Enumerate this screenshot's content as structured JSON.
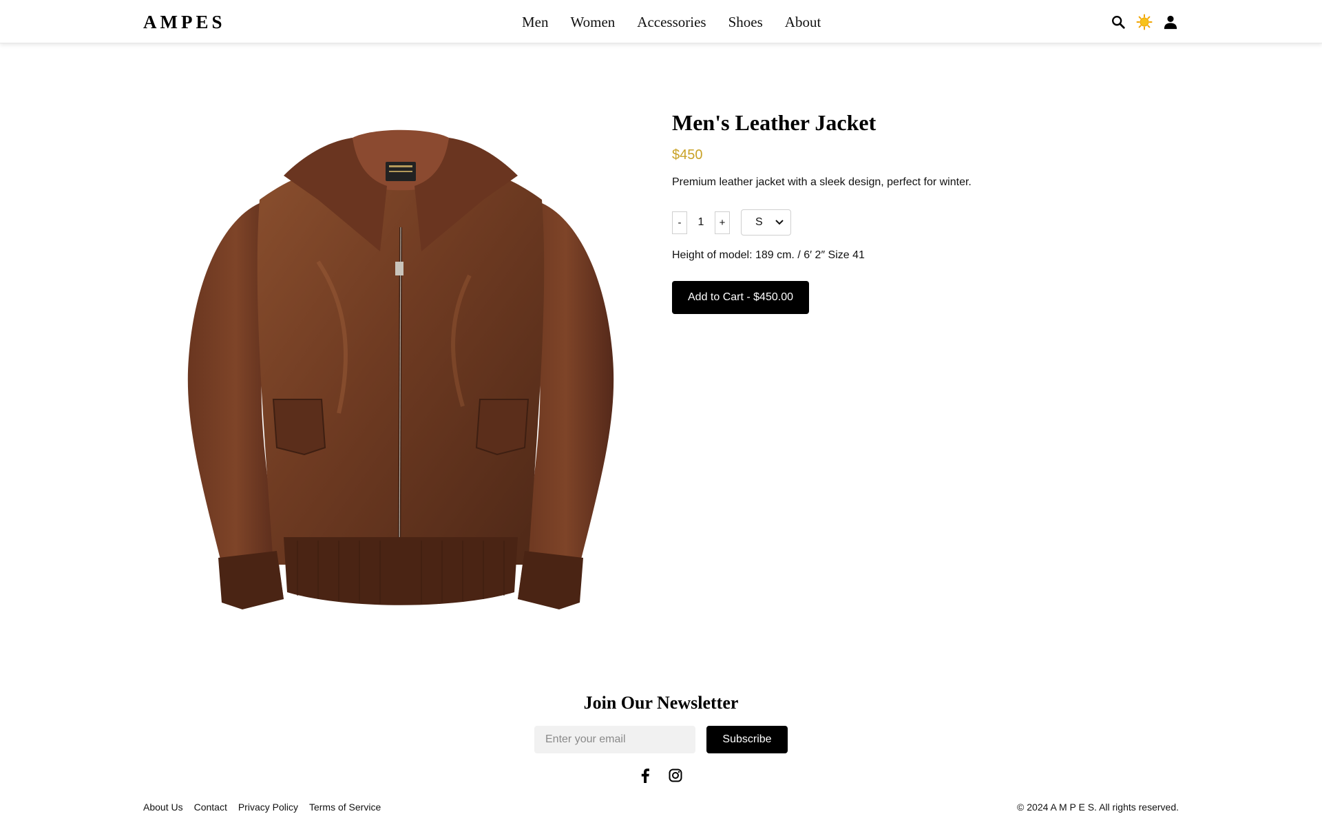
{
  "header": {
    "logo": "AMPES",
    "nav": [
      "Men",
      "Women",
      "Accessories",
      "Shoes",
      "About"
    ],
    "icons": [
      "search-icon",
      "theme-sun-icon",
      "user-icon"
    ]
  },
  "product": {
    "image": "brown-leather-jacket",
    "title": "Men's Leather Jacket",
    "price": "$450",
    "description": "Premium leather jacket with a sleek design, perfect for winter.",
    "qty_minus": "-",
    "quantity": "1",
    "qty_plus": "+",
    "size_selected": "S",
    "model_info": "Height of model: 189 cm. / 6′ 2″ Size 41",
    "add_to_cart": "Add to Cart - $450.00"
  },
  "newsletter": {
    "title": "Join Our Newsletter",
    "email_placeholder": "Enter your email",
    "subscribe": "Subscribe",
    "social_icons": [
      "facebook-icon",
      "instagram-icon"
    ]
  },
  "footer": {
    "links": [
      "About Us",
      "Contact",
      "Privacy Policy",
      "Terms of Service"
    ],
    "copyright": "© 2024 A M P E S. All rights reserved."
  },
  "colors": {
    "accent_price": "#c9a227",
    "button_bg": "#000000",
    "sun": "#f5b301",
    "leather": "#6b3a22"
  }
}
